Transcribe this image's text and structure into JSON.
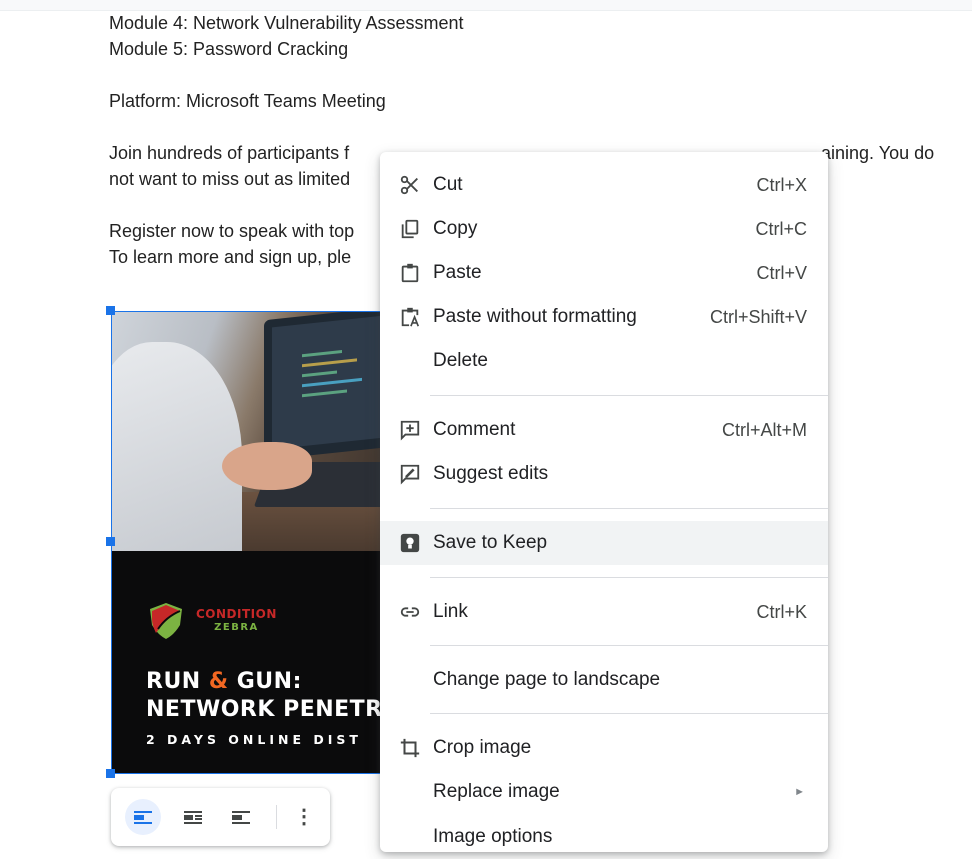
{
  "document": {
    "lines": [
      "Module 4: Network Vulnerability Assessment",
      "Module 5: Password Cracking",
      "Platform: Microsoft Teams Meeting",
      "Join hundreds of participants f",
      "aining. You do",
      "not want to miss out as limited",
      "Register now to speak with top",
      "To learn more and sign up, ple"
    ]
  },
  "image": {
    "brand_name": "CONDITION",
    "brand_sub": "ZEBRA",
    "headline_run": "RUN",
    "headline_amp": "&",
    "headline_gun": "GUN:",
    "headline_line2": "NETWORK PENETR",
    "subline": "2 DAYS ONLINE DIST"
  },
  "image_toolbar": {
    "buttons": [
      "wrap-inline-icon",
      "wrap-text-icon",
      "break-text-icon",
      "more-options-icon"
    ],
    "more_glyph": "⋮"
  },
  "context_menu": {
    "items": [
      {
        "label": "Cut",
        "shortcut": "Ctrl+X",
        "icon": "scissors-icon"
      },
      {
        "label": "Copy",
        "shortcut": "Ctrl+C",
        "icon": "copy-icon"
      },
      {
        "label": "Paste",
        "shortcut": "Ctrl+V",
        "icon": "paste-icon"
      },
      {
        "label": "Paste without formatting",
        "shortcut": "Ctrl+Shift+V",
        "icon": "paste-plain-icon"
      },
      {
        "label": "Delete",
        "shortcut": "",
        "icon": ""
      },
      {
        "label": "Comment",
        "shortcut": "Ctrl+Alt+M",
        "icon": "add-comment-icon"
      },
      {
        "label": "Suggest edits",
        "shortcut": "",
        "icon": "suggest-edits-icon"
      },
      {
        "label": "Save to Keep",
        "shortcut": "",
        "icon": "keep-icon"
      },
      {
        "label": "Link",
        "shortcut": "Ctrl+K",
        "icon": "link-icon"
      },
      {
        "label": "Change page to landscape",
        "shortcut": "",
        "icon": ""
      },
      {
        "label": "Crop image",
        "shortcut": "",
        "icon": "crop-icon"
      },
      {
        "label": "Replace image",
        "shortcut": "",
        "icon": "",
        "submenu_arrow": "►"
      },
      {
        "label": "Image options",
        "shortcut": "",
        "icon": ""
      }
    ]
  },
  "colors": {
    "selection_blue": "#1a73e8",
    "hover_row": "#f1f3f4",
    "brand_red": "#c62828",
    "brand_orange": "#f26722"
  }
}
